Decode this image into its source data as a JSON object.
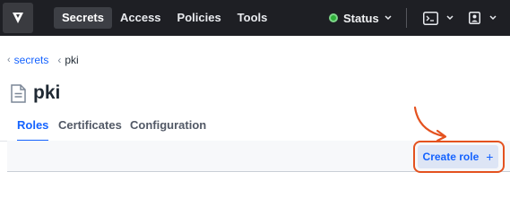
{
  "nav": {
    "logo_icon": "vault-logo-icon",
    "items": [
      {
        "label": "Secrets",
        "active": true
      },
      {
        "label": "Access",
        "active": false
      },
      {
        "label": "Policies",
        "active": false
      },
      {
        "label": "Tools",
        "active": false
      }
    ],
    "status": {
      "label": "Status",
      "color": "#2eb039"
    },
    "console_icon": "terminal-icon",
    "user_icon": "user-icon"
  },
  "breadcrumb": {
    "items": [
      {
        "label": "secrets",
        "link": true
      },
      {
        "label": "pki",
        "link": false
      }
    ]
  },
  "page": {
    "icon": "document-icon",
    "title": "pki"
  },
  "tabs": [
    {
      "label": "Roles",
      "active": true
    },
    {
      "label": "Certificates",
      "active": false
    },
    {
      "label": "Configuration",
      "active": false
    }
  ],
  "toolbar": {
    "create_label": "Create role",
    "create_icon": "plus-icon"
  },
  "colors": {
    "accent": "#1563ff",
    "topbar": "#1e1f24",
    "annotation": "#e4521f"
  }
}
